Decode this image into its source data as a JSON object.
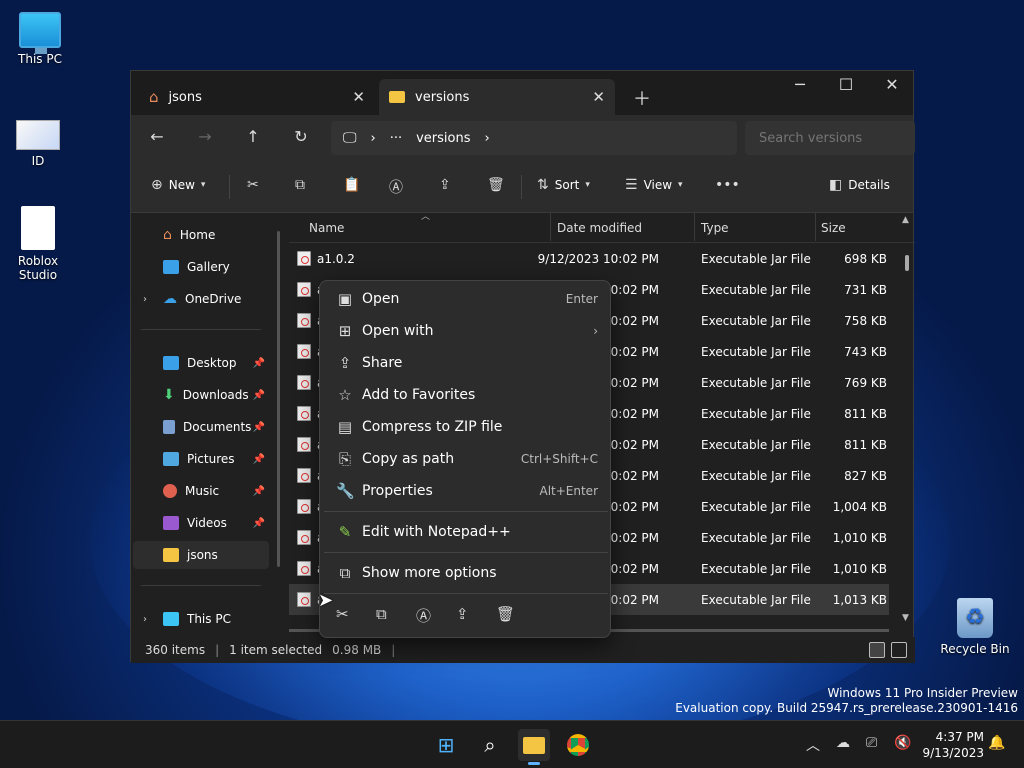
{
  "desktop": {
    "icons": [
      {
        "label": "This PC"
      },
      {
        "label": "ID"
      },
      {
        "label": "Roblox Studio"
      },
      {
        "label": "Recycle Bin"
      }
    ],
    "watermark": {
      "line1": "Windows 11 Pro Insider Preview",
      "line2": "Evaluation copy. Build 25947.rs_prerelease.230901-1416"
    }
  },
  "window": {
    "tabs": [
      {
        "title": "jsons",
        "icon": "home-icon"
      },
      {
        "title": "versions",
        "icon": "folder-icon"
      }
    ],
    "path": {
      "ellipsis": "···",
      "segment": "versions"
    },
    "search_placeholder": "Search versions",
    "toolbar": {
      "new_label": "New",
      "sort_label": "Sort",
      "view_label": "View",
      "details_label": "Details"
    },
    "sidebar": {
      "items": [
        {
          "label": "Home"
        },
        {
          "label": "Gallery"
        },
        {
          "label": "OneDrive"
        },
        {
          "label": "Desktop"
        },
        {
          "label": "Downloads"
        },
        {
          "label": "Documents"
        },
        {
          "label": "Pictures"
        },
        {
          "label": "Music"
        },
        {
          "label": "Videos"
        },
        {
          "label": "jsons"
        },
        {
          "label": "This PC"
        }
      ]
    },
    "columns": {
      "name": "Name",
      "date": "Date modified",
      "type": "Type",
      "size": "Size"
    },
    "files": [
      {
        "name": "a1.0.2",
        "date": "9/12/2023 10:02 PM",
        "type": "Executable Jar File",
        "size": "698 KB"
      },
      {
        "name": "a",
        "date": "10:02 PM",
        "type": "Executable Jar File",
        "size": "731 KB"
      },
      {
        "name": "a",
        "date": "10:02 PM",
        "type": "Executable Jar File",
        "size": "758 KB"
      },
      {
        "name": "a",
        "date": "10:02 PM",
        "type": "Executable Jar File",
        "size": "743 KB"
      },
      {
        "name": "a",
        "date": "10:02 PM",
        "type": "Executable Jar File",
        "size": "769 KB"
      },
      {
        "name": "a",
        "date": "10:02 PM",
        "type": "Executable Jar File",
        "size": "811 KB"
      },
      {
        "name": "a",
        "date": "10:02 PM",
        "type": "Executable Jar File",
        "size": "811 KB"
      },
      {
        "name": "a",
        "date": "10:02 PM",
        "type": "Executable Jar File",
        "size": "827 KB"
      },
      {
        "name": "a",
        "date": "10:02 PM",
        "type": "Executable Jar File",
        "size": "1,004 KB"
      },
      {
        "name": "a",
        "date": "10:02 PM",
        "type": "Executable Jar File",
        "size": "1,010 KB"
      },
      {
        "name": "a",
        "date": "10:02 PM",
        "type": "Executable Jar File",
        "size": "1,010 KB"
      },
      {
        "name": "a",
        "date": "10:02 PM",
        "type": "Executable Jar File",
        "size": "1,013 KB"
      }
    ],
    "status": {
      "count": "360 items",
      "selected": "1 item selected",
      "size": "0.98 MB"
    }
  },
  "context_menu": {
    "items": [
      {
        "label": "Open",
        "shortcut": "Enter"
      },
      {
        "label": "Open with",
        "shortcut": ""
      },
      {
        "label": "Share",
        "shortcut": ""
      },
      {
        "label": "Add to Favorites",
        "shortcut": ""
      },
      {
        "label": "Compress to ZIP file",
        "shortcut": ""
      },
      {
        "label": "Copy as path",
        "shortcut": "Ctrl+Shift+C"
      },
      {
        "label": "Properties",
        "shortcut": "Alt+Enter"
      },
      {
        "label": "Edit with Notepad++",
        "shortcut": ""
      },
      {
        "label": "Show more options",
        "shortcut": ""
      }
    ]
  },
  "taskbar": {
    "time": "4:37 PM",
    "date": "9/13/2023"
  },
  "colors": {
    "accent": "#60b4ff",
    "window_bg": "#202020",
    "menu_bg": "#2c2c2c"
  }
}
